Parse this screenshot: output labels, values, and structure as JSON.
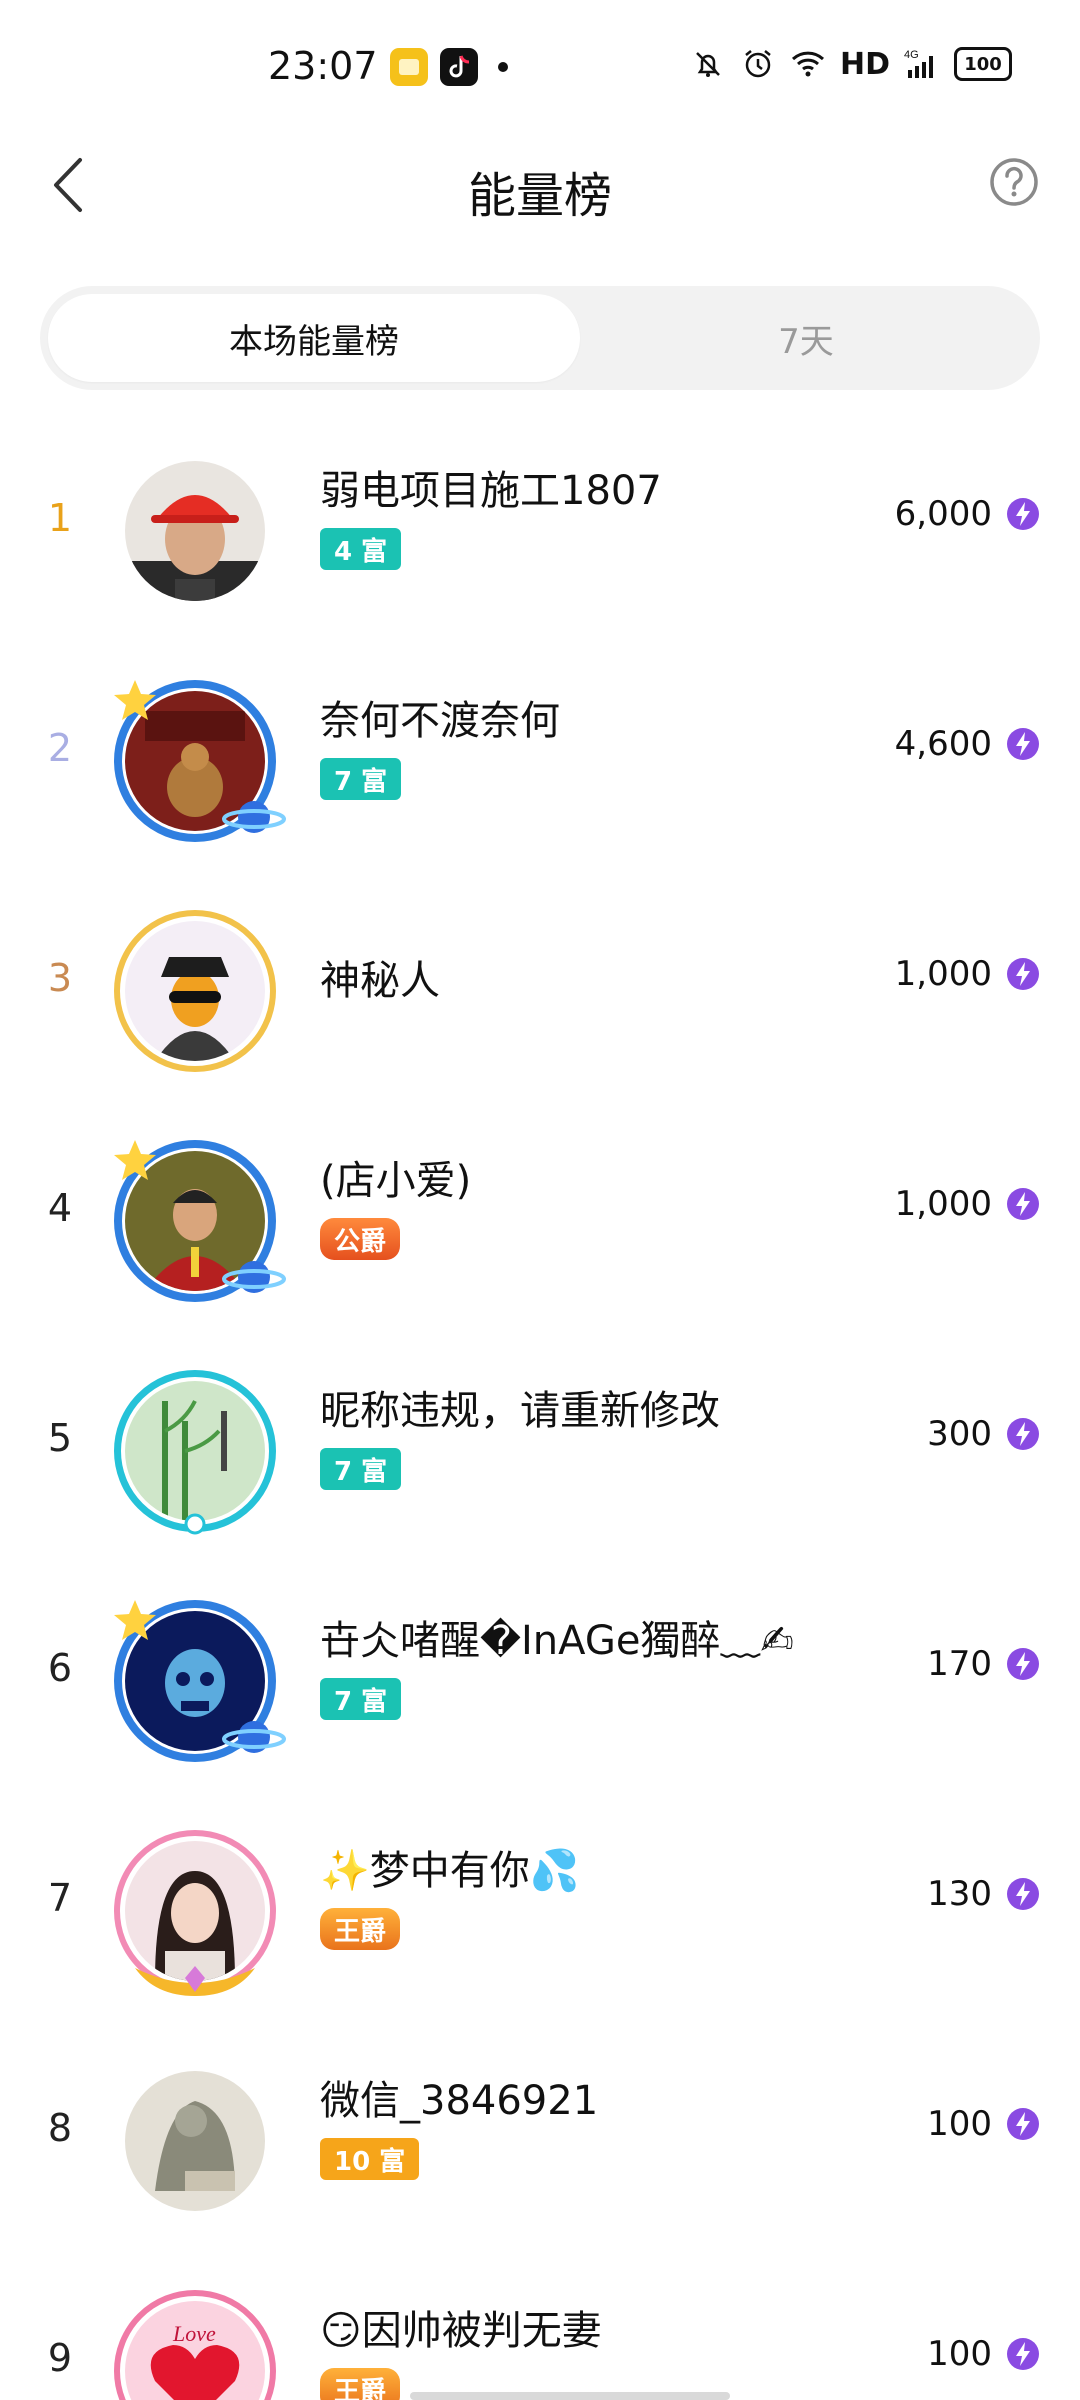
{
  "status_bar": {
    "time": "23:07",
    "hd": "HD",
    "network": "4G",
    "battery": "100"
  },
  "header": {
    "title": "能量榜"
  },
  "tabs": [
    {
      "label": "本场能量榜",
      "active": true
    },
    {
      "label": "7天",
      "active": false
    }
  ],
  "colors": {
    "rank1": "#e9a21a",
    "rank2": "#a9aee3",
    "rank3": "#c98a52",
    "rank_default": "#222222",
    "accent_purple": "#8a4be2",
    "badge_teal": "#1bc2b3",
    "badge_gold": "#f6a51a"
  },
  "entries": [
    {
      "rank": "1",
      "name": "弱电项目施工1807",
      "badge": "4 富",
      "badge_type": "teal",
      "score": "6,000",
      "avatar": "avatar-hardhat-man"
    },
    {
      "rank": "2",
      "name": "奈何不渡奈何",
      "badge": "7 富",
      "badge_type": "teal",
      "score": "4,600",
      "avatar": "avatar-buddha-statue"
    },
    {
      "rank": "3",
      "name": "神秘人",
      "badge": "",
      "badge_type": "none",
      "score": "1,000",
      "avatar": "avatar-mystery-man"
    },
    {
      "rank": "4",
      "name": "(店小爱)",
      "badge": "公爵",
      "badge_type": "orange",
      "score": "1,000",
      "avatar": "avatar-man-red-jacket"
    },
    {
      "rank": "5",
      "name": "昵称违规，请重新修改",
      "badge": "7 富",
      "badge_type": "teal",
      "score": "300",
      "avatar": "avatar-bamboo-painting"
    },
    {
      "rank": "6",
      "name": "卋仌啫醒�InAGe獨醉﹏✍",
      "badge": "7 富",
      "badge_type": "teal",
      "score": "170",
      "avatar": "avatar-skull-blue"
    },
    {
      "rank": "7",
      "name": "✨梦中有你💦",
      "badge": "王爵",
      "badge_type": "king",
      "score": "130",
      "avatar": "avatar-woman"
    },
    {
      "rank": "8",
      "name": "微信_3846921",
      "badge": "10 富",
      "badge_type": "gold",
      "score": "100",
      "avatar": "avatar-stone-sculpture"
    },
    {
      "rank": "9",
      "name": "😏因帅被判无妻",
      "badge": "王爵",
      "badge_type": "king",
      "score": "100",
      "avatar": "avatar-love-heart"
    }
  ]
}
